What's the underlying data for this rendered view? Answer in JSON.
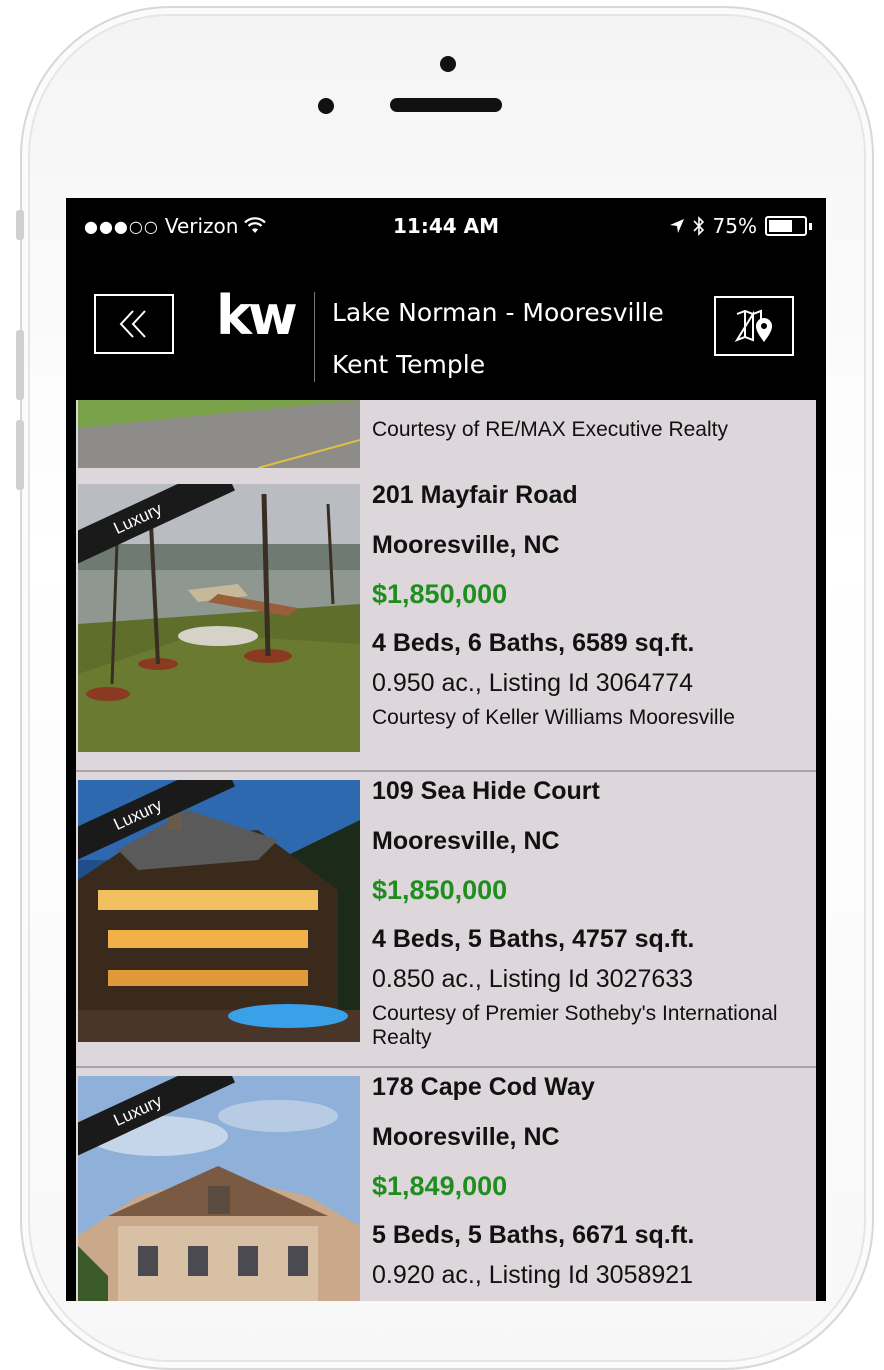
{
  "status_bar": {
    "signal": "●●●○○",
    "carrier": "Verizon",
    "wifi_icon": "wifi-icon",
    "time": "11:44 AM",
    "battery": "75%",
    "battery_level": 0.75
  },
  "navbar": {
    "back_icon": "double-chevron-left-icon",
    "logo": "kw",
    "title": "Lake Norman - Mooresville",
    "subtitle": "Kent Temple",
    "map_icon": "map-pin-icon"
  },
  "colors": {
    "price_green": "#1f8e1f",
    "list_bg": "#ddd6db"
  },
  "listings": [
    {
      "courtesy": "Courtesy of RE/MAX Executive Realty",
      "partial": true
    },
    {
      "badge": "Luxury",
      "address": "201 Mayfair Road",
      "city": "Mooresville, NC",
      "price": "$1,850,000",
      "specs": "4 Beds, 6 Baths, 6589 sq.ft.",
      "lot": "0.950 ac., Listing Id 3064774",
      "courtesy": "Courtesy of Keller Williams Mooresville"
    },
    {
      "badge": "Luxury",
      "address": "109 Sea Hide Court",
      "city": "Mooresville, NC",
      "price": "$1,850,000",
      "specs": "4 Beds, 5 Baths, 4757 sq.ft.",
      "lot": "0.850 ac., Listing Id 3027633",
      "courtesy": "Courtesy of Premier Sotheby's International Realty"
    },
    {
      "badge": "Luxury",
      "address": "178 Cape Cod Way",
      "city": "Mooresville, NC",
      "price": "$1,849,000",
      "specs": "5 Beds, 5 Baths, 6671 sq.ft.",
      "lot": "0.920 ac., Listing Id 3058921"
    }
  ]
}
